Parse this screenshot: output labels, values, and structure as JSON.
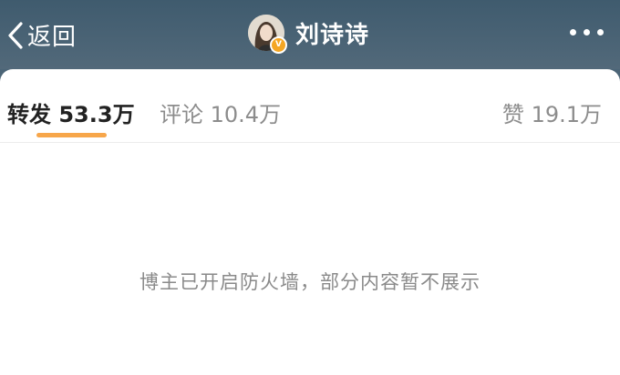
{
  "header": {
    "back_label": "返回",
    "title": "刘诗诗",
    "verified_badge": "V",
    "icons": {
      "back": "chevron-left-icon",
      "more": "more-horizontal-icon"
    }
  },
  "tabs": [
    {
      "label": "转发",
      "count": "53.3万",
      "active": true
    },
    {
      "label": "评论",
      "count": "10.4万",
      "active": false
    },
    {
      "label": "赞",
      "count": "19.1万",
      "active": false
    }
  ],
  "content": {
    "notice": "博主已开启防火墙，部分内容暂不展示"
  },
  "colors": {
    "header_bg": "#4c6577",
    "accent": "#f7a64a",
    "verified": "#f5a623"
  }
}
